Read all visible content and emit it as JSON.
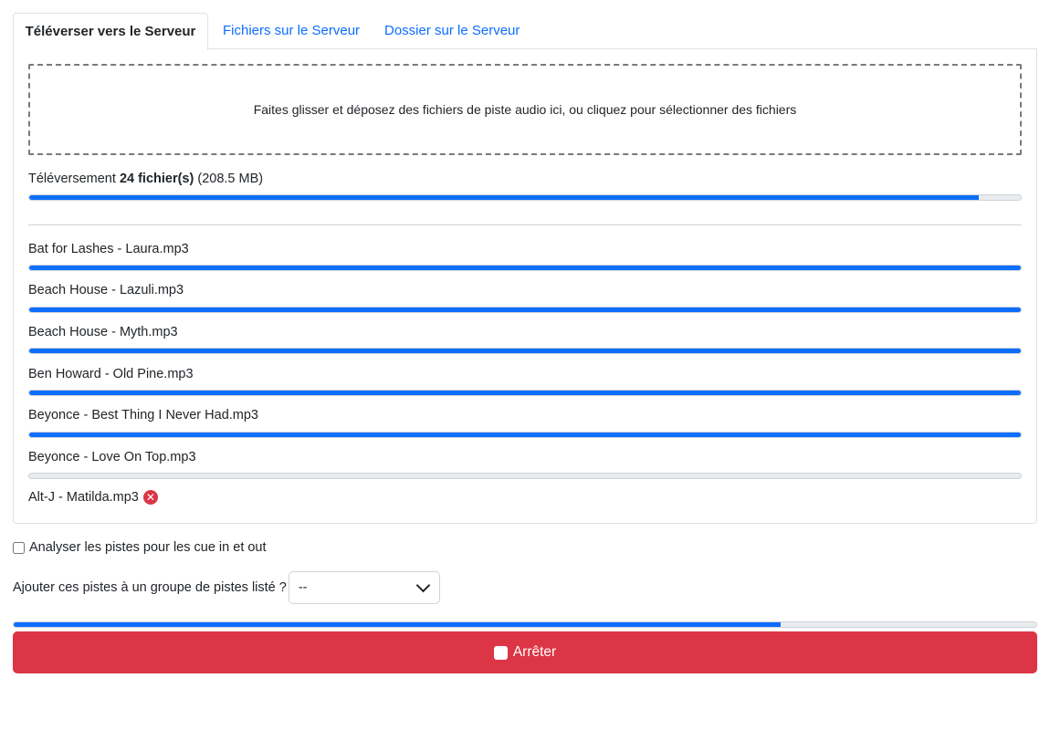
{
  "tabs": [
    {
      "label": "Téléverser vers le Serveur",
      "active": true
    },
    {
      "label": "Fichiers sur le Serveur",
      "active": false
    },
    {
      "label": "Dossier sur le Serveur",
      "active": false
    }
  ],
  "dropzone": {
    "text": "Faites glisser et déposez des fichiers de piste audio ici, ou cliquez pour sélectionner des fichiers"
  },
  "summary": {
    "prefix": "Téléversement",
    "count": "24 fichier(s)",
    "size": "(208.5 MB)",
    "progress": 0.958
  },
  "files": [
    {
      "name": "Bat for Lashes - Laura.mp3",
      "progress": 1.0
    },
    {
      "name": "Beach House - Lazuli.mp3",
      "progress": 1.0
    },
    {
      "name": "Beach House - Myth.mp3",
      "progress": 1.0
    },
    {
      "name": "Ben Howard - Old Pine.mp3",
      "progress": 1.0
    },
    {
      "name": "Beyonce - Best Thing I Never Had.mp3",
      "progress": 1.0
    },
    {
      "name": "Beyonce - Love On Top.mp3",
      "progress": 0.0
    },
    {
      "name": "Alt-J - Matilda.mp3",
      "error": true
    }
  ],
  "options": {
    "analyze_label": "Analyser les pistes pour les cue in et out",
    "analyze_checked": false,
    "group_label": "Ajouter ces pistes à un groupe de pistes listé ?",
    "group_value": "--"
  },
  "overall_progress": 0.75,
  "stop_button": {
    "label": "Arrêter"
  },
  "colors": {
    "accent": "#0d6efd",
    "danger": "#dc3545"
  },
  "icons": {
    "error": "x-circle-icon",
    "stop": "stop-square-icon",
    "select": "chevron-down-icon"
  }
}
